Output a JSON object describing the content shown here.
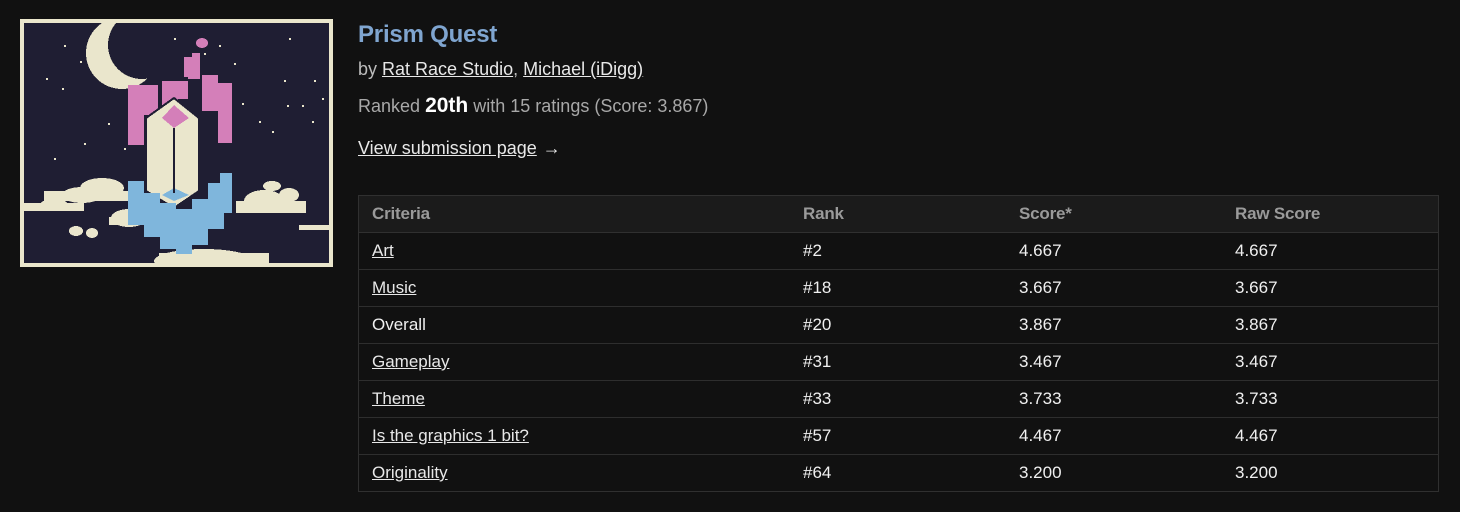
{
  "cover": {
    "alt": "Prism Quest cover art",
    "colors": {
      "sky": "#1f1e33",
      "moon": "#eae6cc",
      "prism_text": "#d47fb9",
      "quest_text": "#7fb6dc",
      "frame": "#eae6cc"
    }
  },
  "game": {
    "title": "Prism Quest",
    "by_prefix": "by",
    "authors": [
      {
        "name": "Rat Race Studio"
      },
      {
        "name": "Michael (iDigg)"
      }
    ],
    "author_separator": ",",
    "ranked_prefix": "Ranked",
    "rank": "20th",
    "ranked_suffix": "with 15 ratings (Score: 3.867)",
    "submission_link": "View submission page",
    "arrow": "→"
  },
  "table": {
    "headers": [
      "Criteria",
      "Rank",
      "Score*",
      "Raw Score"
    ],
    "rows": [
      {
        "criteria": "Art",
        "link": true,
        "rank": "#2",
        "score": "4.667",
        "raw": "4.667"
      },
      {
        "criteria": "Music",
        "link": true,
        "rank": "#18",
        "score": "3.667",
        "raw": "3.667"
      },
      {
        "criteria": "Overall",
        "link": false,
        "rank": "#20",
        "score": "3.867",
        "raw": "3.867"
      },
      {
        "criteria": "Gameplay",
        "link": true,
        "rank": "#31",
        "score": "3.467",
        "raw": "3.467"
      },
      {
        "criteria": "Theme",
        "link": true,
        "rank": "#33",
        "score": "3.733",
        "raw": "3.733"
      },
      {
        "criteria": "Is the graphics 1 bit?",
        "link": true,
        "rank": "#57",
        "score": "4.467",
        "raw": "4.467"
      },
      {
        "criteria": "Originality",
        "link": true,
        "rank": "#64",
        "score": "3.200",
        "raw": "3.200"
      }
    ]
  }
}
